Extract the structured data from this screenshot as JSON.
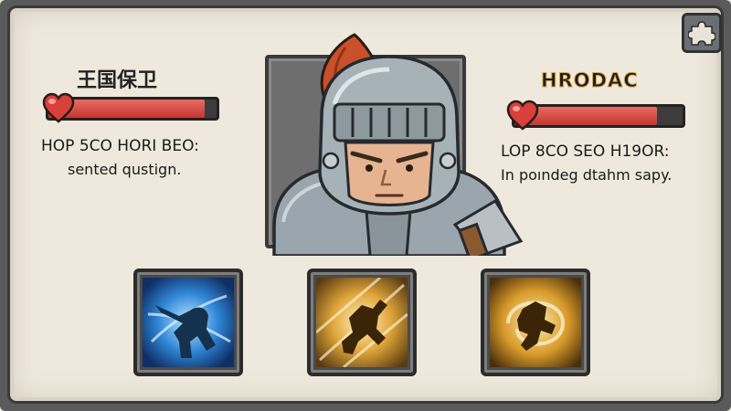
{
  "left_unit": {
    "title": "王国保卫",
    "hp_fraction": 0.93,
    "stat_line": "HOP 5CO HORI BEO:",
    "description": "sented qustign."
  },
  "right_unit": {
    "title": "HRODAC",
    "hp_fraction": 0.85,
    "stat_line": "LOP 8CO SEO H19OR:",
    "description": "In poındeg dtahm sapy."
  },
  "portrait": {
    "subject": "armored knight with red plume"
  },
  "abilities": [
    {
      "name": "frost-strike",
      "theme_color": "#3aa0e8"
    },
    {
      "name": "golden-dash",
      "theme_color": "#e0a63a"
    },
    {
      "name": "golden-whirl",
      "theme_color": "#d89a2a"
    }
  ],
  "icons": {
    "menu_button": "puzzle-piece-icon",
    "hp": "heart-icon"
  },
  "colors": {
    "hp_fill": "#d8423b",
    "panel_bg": "#efe9dd",
    "frame": "#3a3a3a",
    "title_right_outline": "#e0a63a"
  }
}
